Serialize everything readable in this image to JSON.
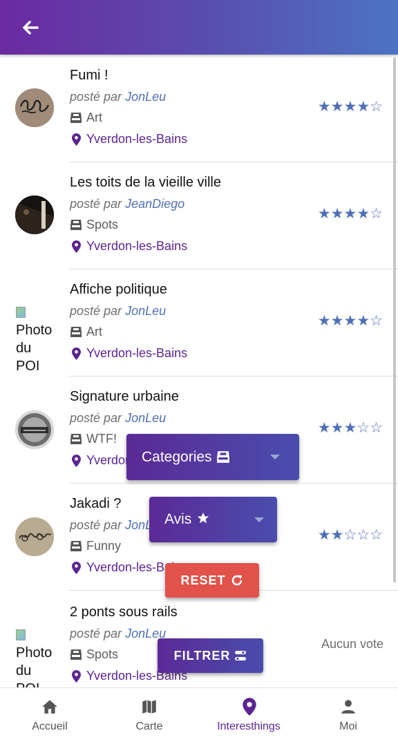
{
  "appbar": {
    "back_icon": "arrow-left-icon"
  },
  "items": [
    {
      "title": "Fumi !",
      "posted_prefix": "posté par",
      "user": "JonLeu",
      "category": "Art",
      "city": "Yverdon-les-Bains",
      "rating": 4,
      "rating_text": "★★★★☆"
    },
    {
      "title": "Les toits de la vieille ville",
      "posted_prefix": "posté par",
      "user": "JeanDiego",
      "category": "Spots",
      "city": "Yverdon-les-Bains",
      "rating": 4,
      "rating_text": "★★★★☆"
    },
    {
      "title": "Affiche politique",
      "posted_prefix": "posté par",
      "user": "JonLeu",
      "category": "Art",
      "city": "Yverdon-les-Bains",
      "rating": 4,
      "rating_text": "★★★★☆",
      "img_alt": "Photo du POI"
    },
    {
      "title": "Signature urbaine",
      "posted_prefix": "posté par",
      "user": "JonLeu",
      "category": "WTF!",
      "city": "Yverdon-les-Bains",
      "rating": 3,
      "rating_text": "★★★☆☆"
    },
    {
      "title": "Jakadi ?",
      "posted_prefix": "posté par",
      "user": "JonLeu",
      "category": "Funny",
      "city": "Yverdon-les-Bains",
      "rating": 2,
      "rating_text": "★★☆☆☆"
    },
    {
      "title": "2 ponts sous rails",
      "posted_prefix": "posté par",
      "user": "JonLeu",
      "category": "Spots",
      "city": "Yverdon-les-Bains",
      "no_vote": "Aucun vote",
      "img_alt": "Photo du POI"
    }
  ],
  "filters": {
    "categories_label": "Categories",
    "avis_label": "Avis",
    "reset_label": "RESET",
    "filter_label": "FILTRER",
    "reset_color": "#e0524a"
  },
  "bottom_nav": [
    {
      "label": "Accueil",
      "icon": "home-icon"
    },
    {
      "label": "Carte",
      "icon": "map-icon"
    },
    {
      "label": "Interesthings",
      "icon": "map-pin-icon",
      "active": true
    },
    {
      "label": "Moi",
      "icon": "person-icon"
    }
  ],
  "colors": {
    "accent": "#5b2491",
    "star": "#4f6fb8",
    "header_start": "#6b2aa0",
    "header_end": "#4c73c3"
  }
}
